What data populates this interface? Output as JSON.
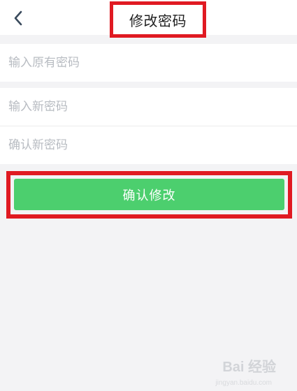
{
  "header": {
    "title": "修改密码",
    "back_icon": "chevron-left-icon"
  },
  "form": {
    "old_password_placeholder": "输入原有密码",
    "new_password_placeholder": "输入新密码",
    "confirm_password_placeholder": "确认新密码"
  },
  "confirm_button": {
    "label": "确认修改"
  },
  "watermark": {
    "text": "Bai 经验",
    "url": "jingyan.baidu.com"
  },
  "colors": {
    "accent_green": "#4ccf6e",
    "highlight_red": "#e01a22",
    "background": "#f3f3f5"
  }
}
